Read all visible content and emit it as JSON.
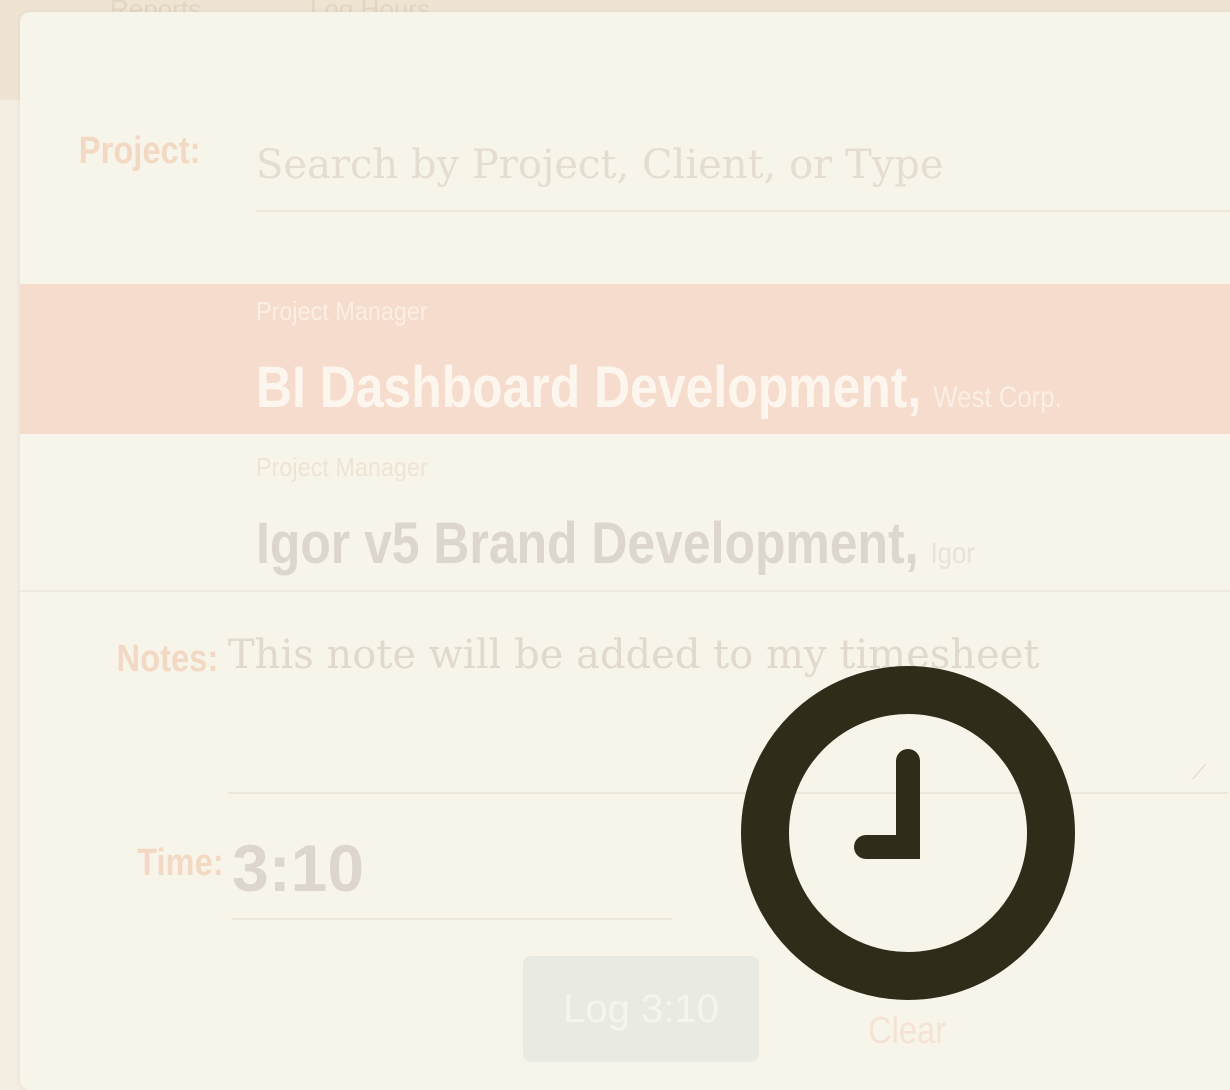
{
  "background": {
    "crumbs": [
      "Reports",
      "Log Hours"
    ]
  },
  "form": {
    "project_label": "Project:",
    "search_placeholder": "Search by Project, Client, or Type",
    "results": [
      {
        "role": "Project Manager",
        "project": "BI Dashboard Development,",
        "client": "West Corp.",
        "selected": true
      },
      {
        "role": "Project Manager",
        "project": "Igor v5 Brand Development,",
        "client": "Igor",
        "selected": false
      }
    ],
    "notes_label": "Notes:",
    "notes_placeholder": "This note will be added to my timesheet",
    "time_label": "Time:",
    "time_value": "3:10",
    "log_button_label": "Log 3:10",
    "clear_label": "Clear"
  },
  "overlay": {
    "icon": "clock-icon",
    "color": "#2f2c1a"
  },
  "colors": {
    "accent_label": "#f3d9c4",
    "selected_row": "#f5dccd",
    "modal_bg": "#f7f4ea"
  }
}
